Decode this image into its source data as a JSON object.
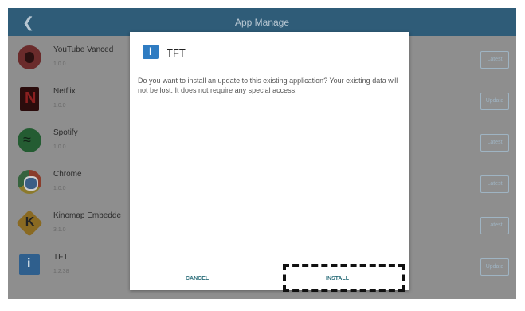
{
  "header": {
    "back_icon": "chevron-left-icon",
    "title": "App Manage"
  },
  "apps": [
    {
      "name": "YouTube Vanced",
      "version": "1.0.0",
      "action": "Latest",
      "icon": "youtube-vanced-icon"
    },
    {
      "name": "Netflix",
      "version": "1.0.0",
      "action": "Update",
      "icon": "netflix-icon"
    },
    {
      "name": "Spotify",
      "version": "1.0.0",
      "action": "Latest",
      "icon": "spotify-icon"
    },
    {
      "name": "Chrome",
      "version": "1.0.0",
      "action": "Latest",
      "icon": "chrome-icon"
    },
    {
      "name": "Kinomap Embedde",
      "version": "3.1.0",
      "action": "Latest",
      "icon": "kinomap-icon"
    },
    {
      "name": "TFT",
      "version": "1.2.38",
      "action": "Update",
      "icon": "tft-icon"
    }
  ],
  "dialog": {
    "icon": "info-icon",
    "title": "TFT",
    "message": "Do you want to install an update to this existing application? Your existing data will not be lost. It does not require any special access.",
    "cancel_label": "CANCEL",
    "install_label": "INSTALL"
  },
  "colors": {
    "topbar": "#2f5c78",
    "overlay": "#8e8e8e",
    "accent": "#2d6f7b"
  }
}
